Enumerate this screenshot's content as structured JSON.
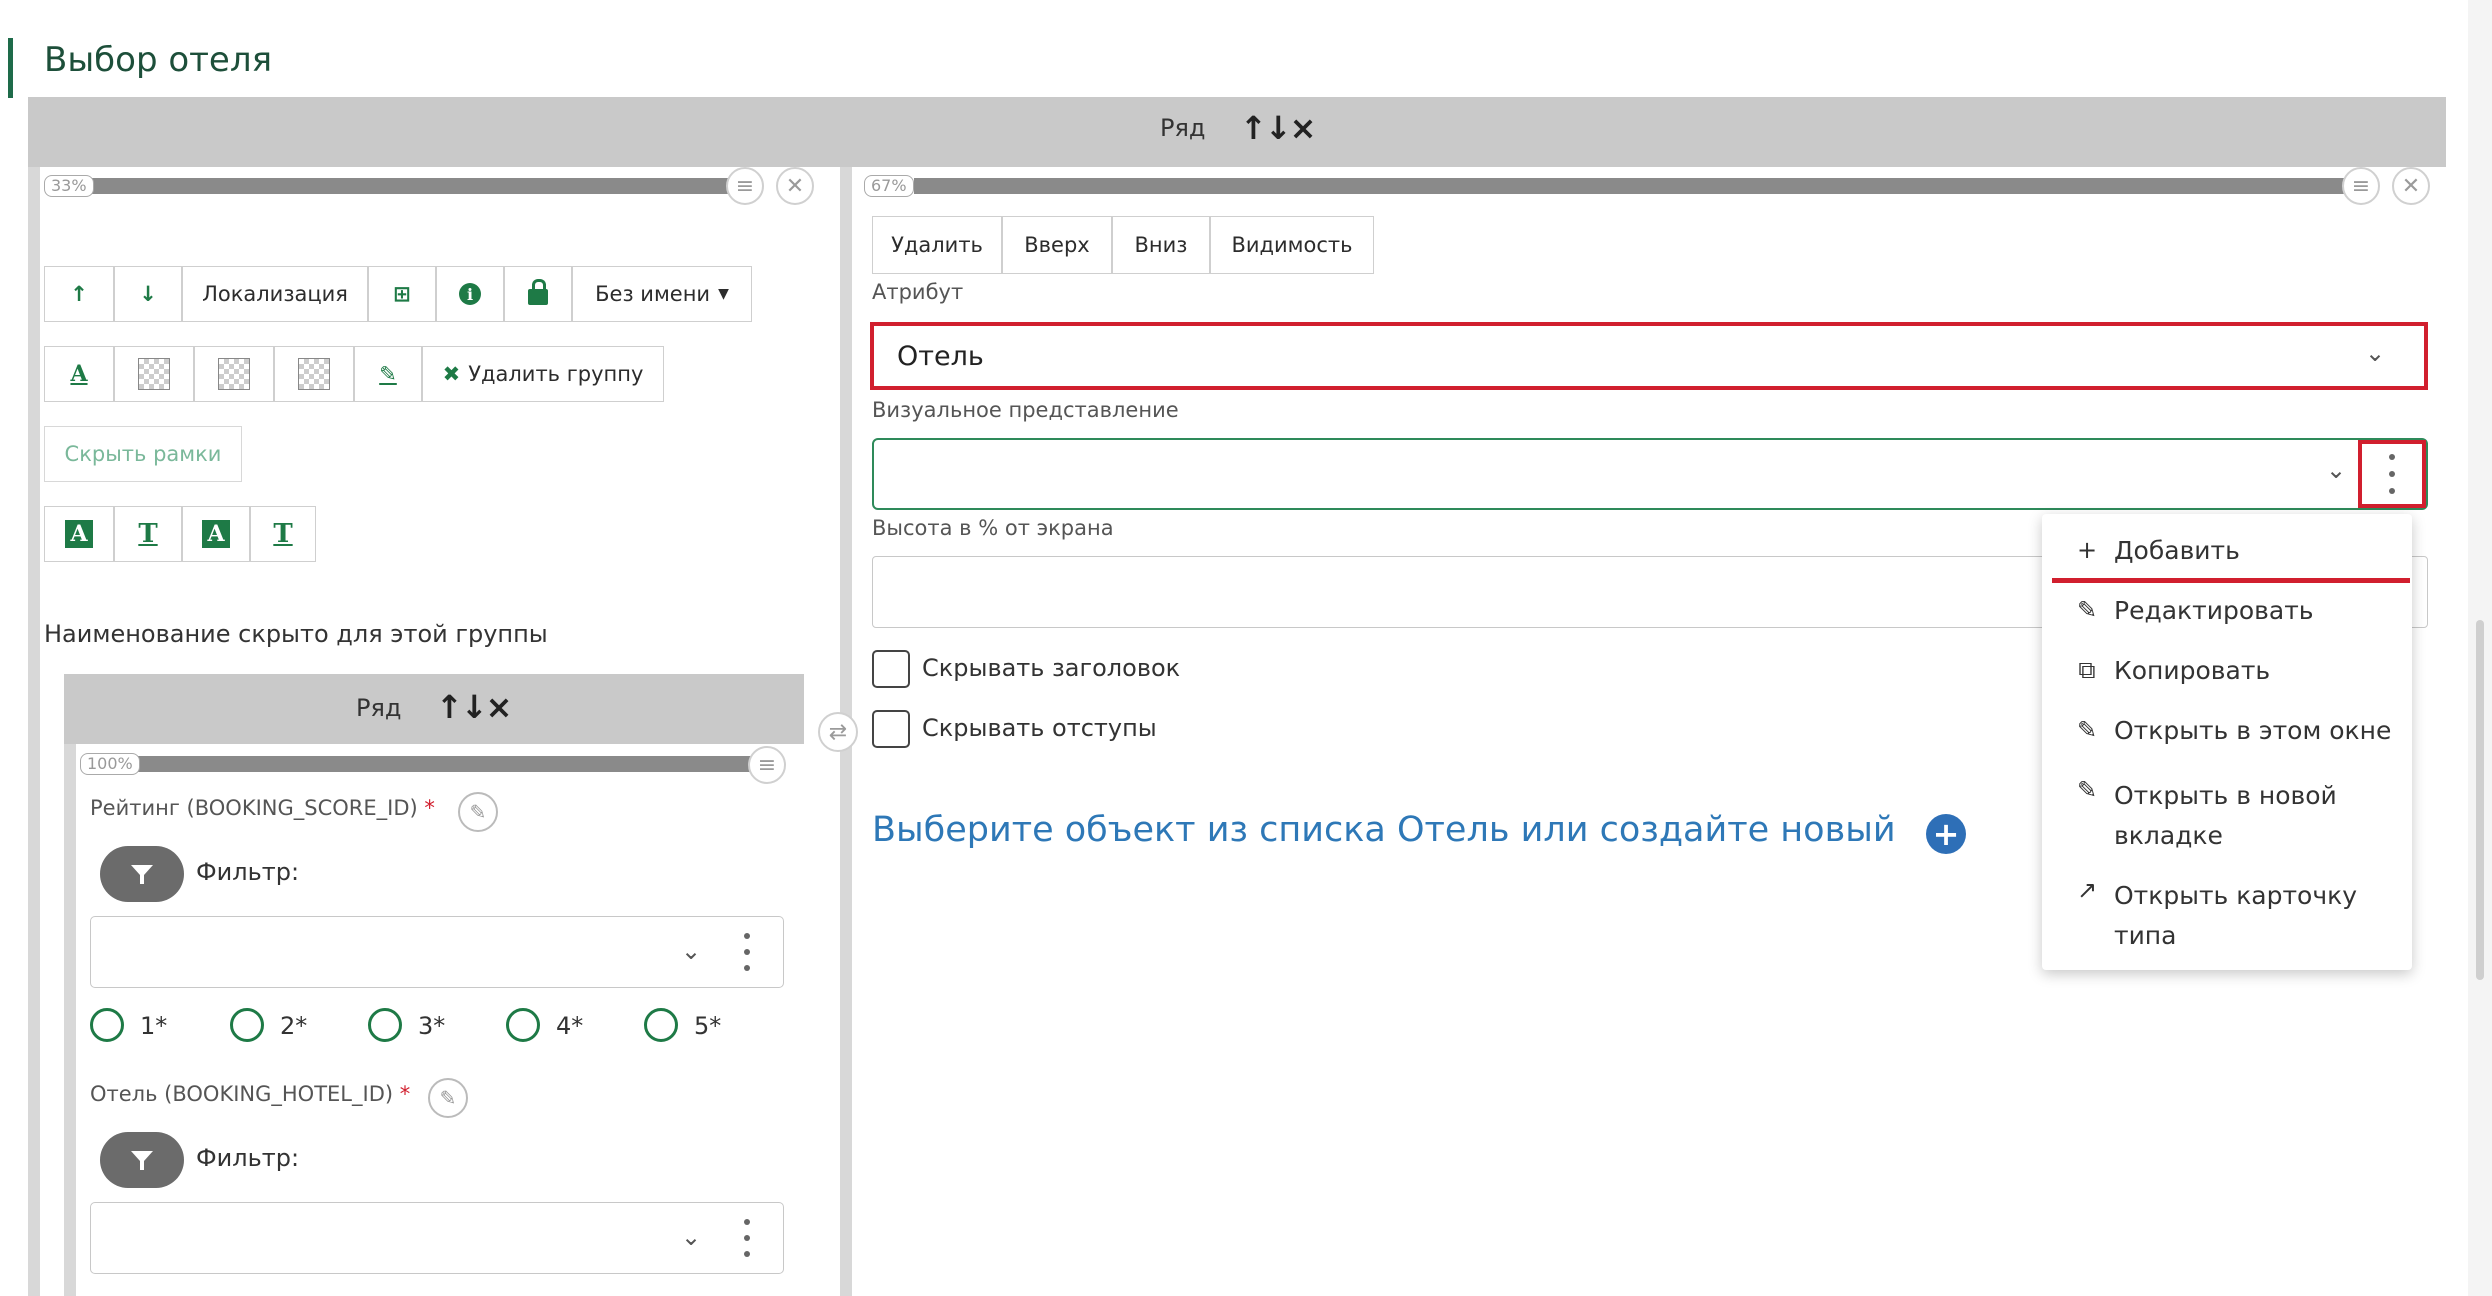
{
  "page": {
    "title": "Выбор отеля"
  },
  "outer_row": {
    "label": "Ряд",
    "icons": "up-down-remove-icons"
  },
  "left_column": {
    "width_pct": "33%",
    "toolbar1": {
      "localization": "Локализация",
      "no_name": "Без имени"
    },
    "toolbar2": {
      "delete_group": "Удалить группу"
    },
    "hide_frames": "Скрыть рамки",
    "hidden_name_note": "Наименование скрыто для этой группы",
    "inner_row": {
      "label": "Ряд",
      "width_pct": "100%",
      "rating": {
        "label": "Рейтинг (BOOKING_SCORE_ID)",
        "required": "*",
        "filter_label": "Фильтр:",
        "options": [
          "1*",
          "2*",
          "3*",
          "4*",
          "5*"
        ]
      },
      "hotel": {
        "label": "Отель (BOOKING_HOTEL_ID)",
        "required": "*",
        "filter_label": "Фильтр:"
      }
    }
  },
  "right_column": {
    "width_pct": "67%",
    "buttons": {
      "delete": "Удалить",
      "up": "Вверх",
      "down": "Вниз",
      "visibility": "Видимость"
    },
    "attribute_label": "Атрибут",
    "attribute_value": "Отель",
    "visual_label": "Визуальное представление",
    "visual_value": "",
    "height_label": "Высота в % от экрана",
    "height_value": "",
    "hide_header": "Скрывать заголовок",
    "hide_padding": "Скрывать отступы",
    "prompt": "Выберите объект из списка Отель или создайте новый"
  },
  "context_menu": {
    "add": "Добавить",
    "edit": "Редактировать",
    "copy": "Копировать",
    "open_here": "Открыть в этом окне",
    "open_new_1": "Открыть в новой",
    "open_new_2": "вкладке",
    "open_type_1": "Открыть карточку",
    "open_type_2": "типа"
  },
  "colors": {
    "accent_green": "#1e7a46",
    "title_green": "#1d4f3a",
    "highlight_red": "#d11f2e",
    "link_blue": "#2e78b7"
  }
}
